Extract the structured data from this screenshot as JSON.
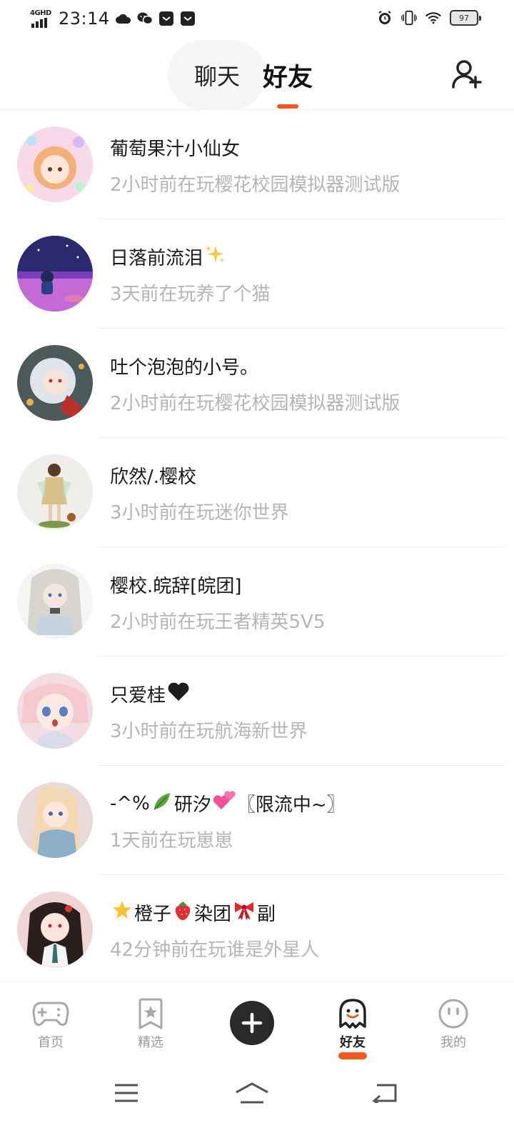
{
  "status_bar": {
    "network": "4GHD",
    "time": "23:14",
    "battery": "97",
    "icons": [
      "cloud-icon",
      "wechat-icon",
      "message-icon",
      "message-icon",
      "alarm-icon",
      "vibrate-icon",
      "wifi-icon",
      "battery-icon"
    ]
  },
  "header": {
    "tab_chat": "聊天",
    "tab_friends": "好友",
    "add_friend_icon": "add-friend-icon",
    "accent": "#f05a22"
  },
  "friends": [
    {
      "name": "葡萄果汁小仙女",
      "emoji": "",
      "status": "2小时前在玩樱花校园模拟器测试版"
    },
    {
      "name": "日落前流泪",
      "emoji": "sparkles",
      "status": "3天前在玩养了个猫"
    },
    {
      "name": "吐个泡泡的小号。",
      "emoji": "",
      "status": "2小时前在玩樱花校园模拟器测试版"
    },
    {
      "name": "欣然/.樱校",
      "emoji": "",
      "status": "3小时前在玩迷你世界"
    },
    {
      "name": "樱校.皖辞[皖团]",
      "emoji": "",
      "status": "2小时前在玩王者精英5V5"
    },
    {
      "name": "只爱桂",
      "emoji": "black-heart",
      "status": "3小时前在玩航海新世界"
    },
    {
      "name_parts": [
        "-^%",
        "研汐",
        "〖限流中~〗"
      ],
      "status": "1天前在玩崽崽"
    },
    {
      "name_parts": [
        "橙子 ",
        "染团 ",
        "副"
      ],
      "status": "42分钟前在玩谁是外星人"
    }
  ],
  "bottom_nav": {
    "home": "首页",
    "featured": "精选",
    "friends": "好友",
    "mine": "我的",
    "create_icon": "plus-icon"
  },
  "system_nav": [
    "menu-icon",
    "home-icon",
    "back-icon"
  ]
}
